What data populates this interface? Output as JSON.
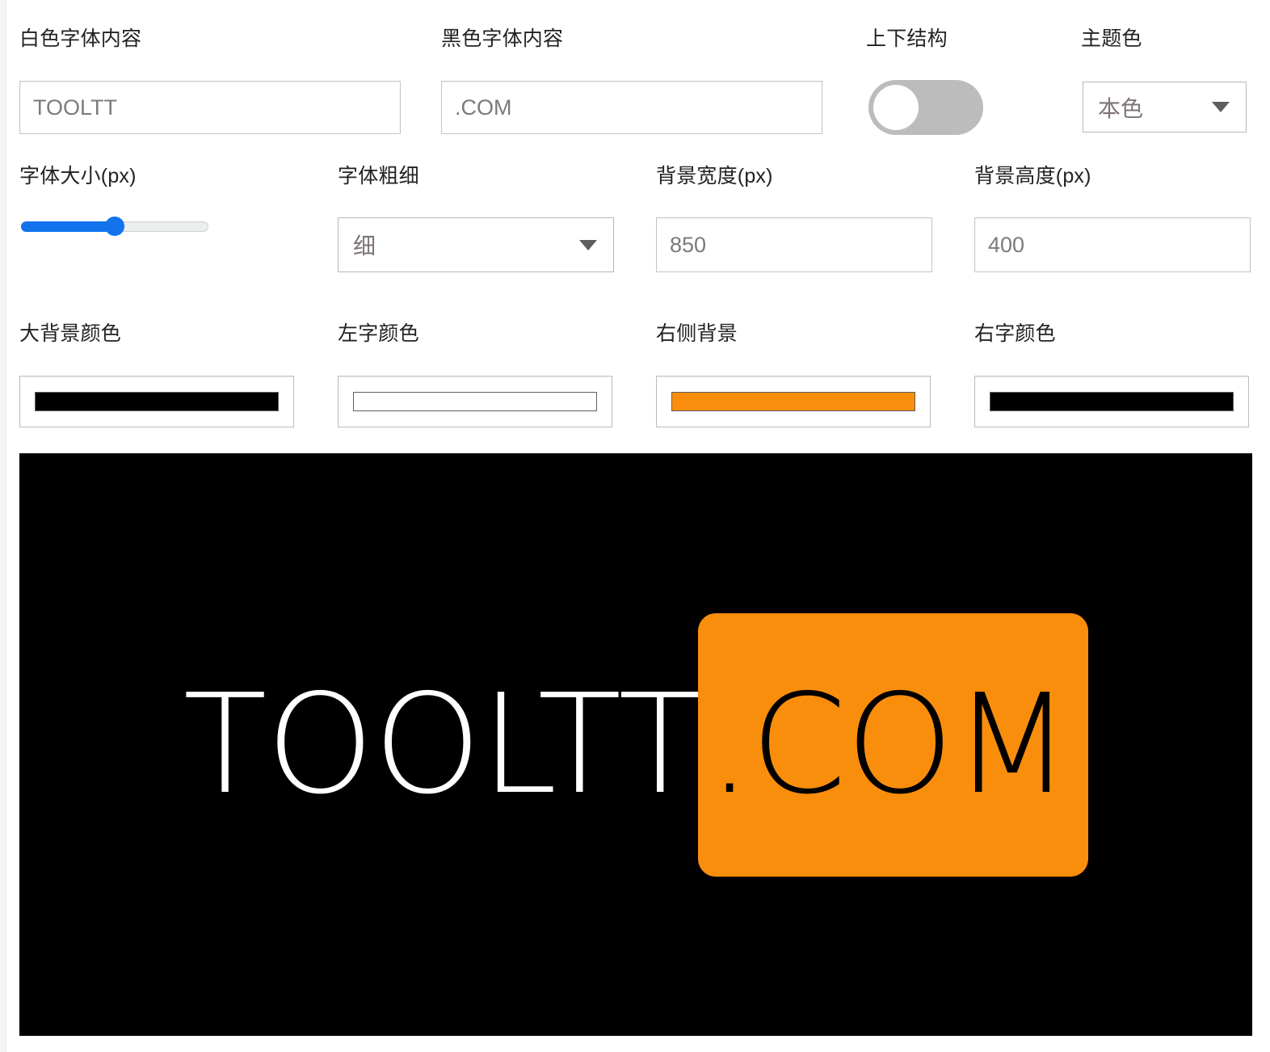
{
  "theme": {
    "accent_blue": "#1273ec",
    "orange": "#F98D0C",
    "black": "#000000",
    "white": "#FFFFFF",
    "border_gray": "#c6c6c6"
  },
  "form": {
    "row1": {
      "white_text": {
        "label": "白色字体内容",
        "value": "TOOLTT",
        "placeholder": "TOOLTT"
      },
      "black_text": {
        "label": "黑色字体内容",
        "value": ".COM",
        "placeholder": ".COM"
      },
      "stacked_layout": {
        "label": "上下结构",
        "state": "off"
      },
      "theme_color": {
        "label": "主题色",
        "value": "本色",
        "options": [
          "本色"
        ]
      }
    },
    "row2": {
      "font_size": {
        "label": "字体大小(px)",
        "percent": 50
      },
      "font_weight": {
        "label": "字体粗细",
        "value": "细",
        "options": [
          "细"
        ]
      },
      "bg_width": {
        "label": "背景宽度(px)",
        "value": "850",
        "placeholder": "850"
      },
      "bg_height": {
        "label": "背景高度(px)",
        "value": "400",
        "placeholder": "400"
      }
    },
    "row3": {
      "main_bg_color": {
        "label": "大背景颜色",
        "value": "#000000"
      },
      "left_text_color": {
        "label": "左字颜色",
        "value": "#FFFFFF"
      },
      "right_bg_color": {
        "label": "右侧背景",
        "value": "#F98D0C"
      },
      "right_text_color": {
        "label": "右字颜色",
        "value": "#000000"
      }
    }
  },
  "preview": {
    "background": "#000000",
    "left_text": "TOOLTT",
    "left_text_color": "#FFFFFF",
    "right_text": ".COM",
    "right_text_color": "#000000",
    "right_bg_color": "#F98D0C"
  }
}
